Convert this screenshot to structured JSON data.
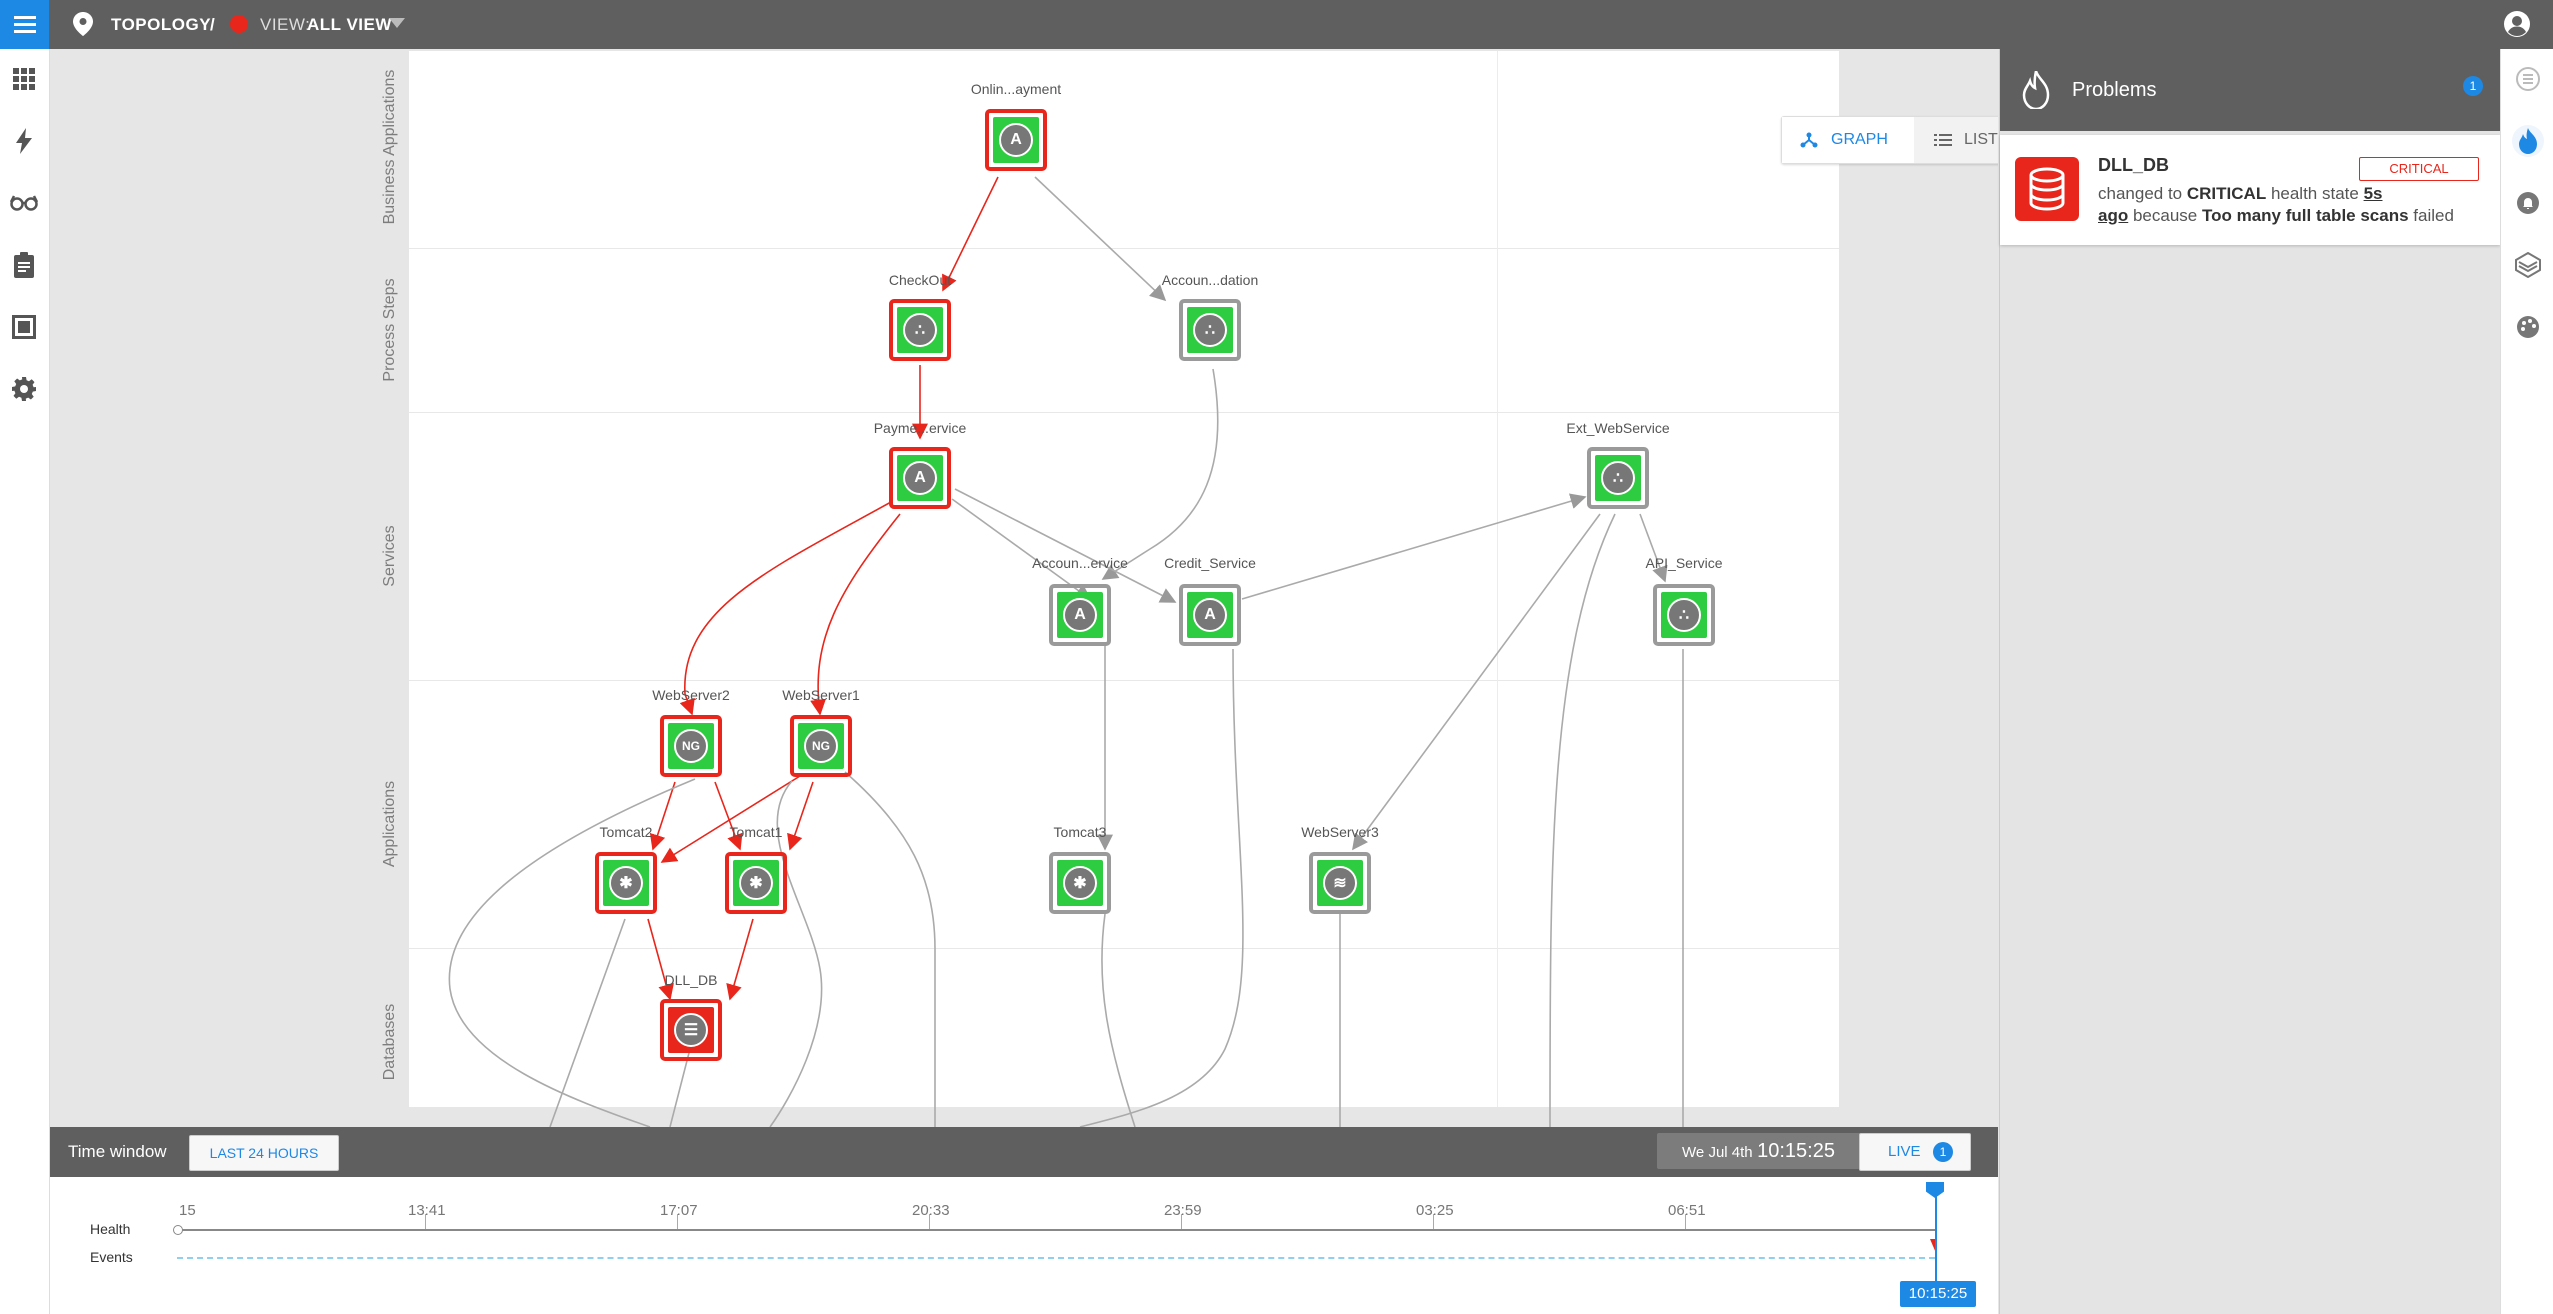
{
  "header": {
    "breadcrumb_root": "TOPOLOGY",
    "separator": "/",
    "view_prefix": "VIEW:",
    "view_name": "ALL VIEW"
  },
  "lanes": [
    "Business Applications",
    "Process Steps",
    "Services",
    "Applications",
    "Databases"
  ],
  "nodes": {
    "online_payment": "Onlin...ayment",
    "checkout": "CheckOut",
    "account_validation": "Accoun...dation",
    "payment_service": "Payme...ervice",
    "ext_webservice": "Ext_WebService",
    "account_service": "Accoun...ervice",
    "credit_service": "Credit_Service",
    "api_service": "API_Service",
    "webserver2": "WebServer2",
    "webserver1": "WebServer1",
    "tomcat2": "Tomcat2",
    "tomcat1": "Tomcat1",
    "tomcat3": "Tomcat3",
    "webserver3": "WebServer3",
    "dll_db": "DLL_DB"
  },
  "glyphs": {
    "app": "A",
    "nginx": "NG"
  },
  "view_toggle": {
    "graph": "GRAPH",
    "list": "LIST"
  },
  "zoom": {
    "in": "+",
    "fit": "⛶",
    "out": "-"
  },
  "time_window": {
    "label": "Time window",
    "range_button": "LAST 24 HOURS",
    "date": "We Jul 4th",
    "time": "10:15:25",
    "live": "LIVE",
    "live_count": "1"
  },
  "timeline": {
    "health_label": "Health",
    "events_label": "Events",
    "ticks": [
      "15",
      "13:41",
      "17:07",
      "20:33",
      "23:59",
      "03:25",
      "06:51"
    ],
    "cursor_time": "10:15:25"
  },
  "problems": {
    "title": "Problems",
    "count": "1",
    "item": {
      "name": "DLL_DB",
      "severity": "CRITICAL",
      "text_1": "changed to",
      "state": "CRITICAL",
      "text_2": "health state",
      "age_1": "5s",
      "age_2": "ago",
      "text_3": "because",
      "reason": "Too many full table scans",
      "text_4": "failed"
    }
  },
  "colors": {
    "accent": "#1e88e5",
    "critical": "#e8261b",
    "healthy": "#2ecc40",
    "topbar": "#5f5f5f"
  }
}
